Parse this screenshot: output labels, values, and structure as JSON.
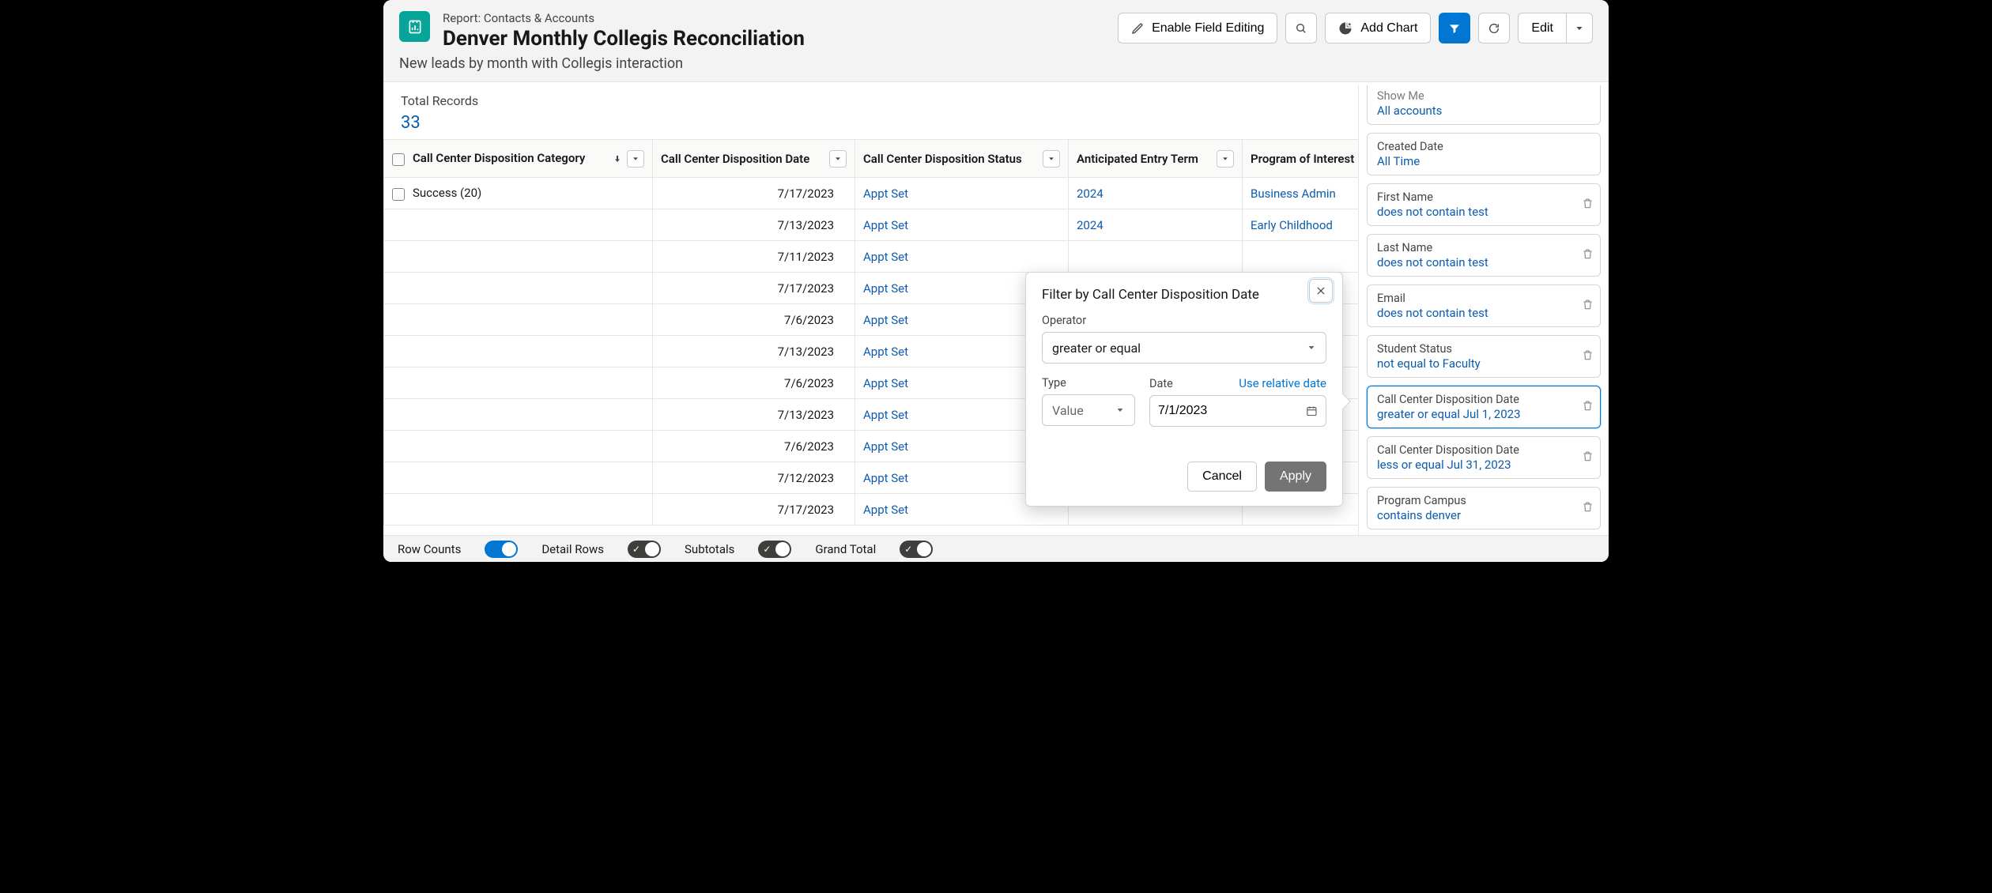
{
  "header": {
    "breadcrumb": "Report: Contacts & Accounts",
    "title": "Denver Monthly Collegis Reconciliation",
    "subtitle": "New leads by month with Collegis interaction",
    "actions": {
      "enable_field_editing": "Enable Field Editing",
      "add_chart": "Add Chart",
      "edit": "Edit"
    }
  },
  "summary": {
    "total_records_label": "Total Records",
    "total_records_value": "33"
  },
  "columns": {
    "c1": "Call Center Disposition Category",
    "c2": "Call Center Disposition Date",
    "c3": "Call Center Disposition Status",
    "c4": "Anticipated Entry Term",
    "c5": "Program of Interest"
  },
  "group_row": "Success (20)",
  "rows": [
    {
      "date": "7/17/2023",
      "status": "Appt Set",
      "term": "2024",
      "program": "Business Admin"
    },
    {
      "date": "7/13/2023",
      "status": "Appt Set",
      "term": "2024",
      "program": "Early Childhood"
    },
    {
      "date": "7/11/2023",
      "status": "Appt Set",
      "term": "",
      "program": ""
    },
    {
      "date": "7/17/2023",
      "status": "Appt Set",
      "term": "",
      "program": ""
    },
    {
      "date": "7/6/2023",
      "status": "Appt Set",
      "term": "",
      "program": ""
    },
    {
      "date": "7/13/2023",
      "status": "Appt Set",
      "term": "",
      "program": ""
    },
    {
      "date": "7/6/2023",
      "status": "Appt Set",
      "term": "",
      "program": ""
    },
    {
      "date": "7/13/2023",
      "status": "Appt Set",
      "term": "",
      "program": ""
    },
    {
      "date": "7/6/2023",
      "status": "Appt Set",
      "term": "",
      "program": ""
    },
    {
      "date": "7/12/2023",
      "status": "Appt Set",
      "term": "",
      "program": ""
    },
    {
      "date": "7/17/2023",
      "status": "Appt Set",
      "term": "",
      "program": ""
    }
  ],
  "filters": [
    {
      "label": "Show Me",
      "value": "All accounts",
      "deletable": false,
      "hint": true
    },
    {
      "label": "Created Date",
      "value": "All Time",
      "deletable": false
    },
    {
      "label": "First Name",
      "value": "does not contain test",
      "deletable": true
    },
    {
      "label": "Last Name",
      "value": "does not contain test",
      "deletable": true
    },
    {
      "label": "Email",
      "value": "does not contain test",
      "deletable": true
    },
    {
      "label": "Student Status",
      "value": "not equal to Faculty",
      "deletable": true
    },
    {
      "label": "Call Center Disposition Date",
      "value": "greater or equal Jul 1, 2023",
      "deletable": true,
      "selected": true
    },
    {
      "label": "Call Center Disposition Date",
      "value": "less or equal Jul 31, 2023",
      "deletable": true
    },
    {
      "label": "Program Campus",
      "value": "contains denver",
      "deletable": true
    }
  ],
  "footer": {
    "row_counts": "Row Counts",
    "detail_rows": "Detail Rows",
    "subtotals": "Subtotals",
    "grand_total": "Grand Total"
  },
  "popover": {
    "title": "Filter by Call Center Disposition Date",
    "operator_label": "Operator",
    "operator_value": "greater or equal",
    "type_label": "Type",
    "type_value": "Value",
    "date_label": "Date",
    "relative": "Use relative date",
    "date_value": "7/1/2023",
    "cancel": "Cancel",
    "apply": "Apply"
  }
}
